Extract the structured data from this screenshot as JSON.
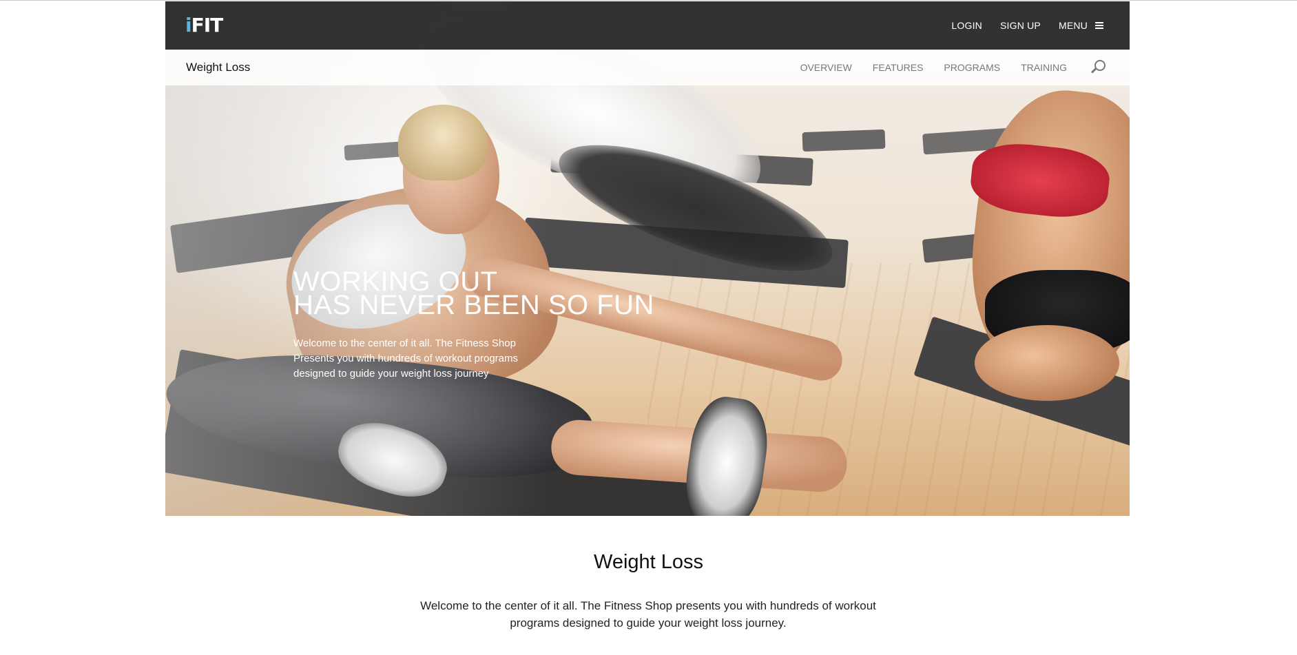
{
  "brand": {
    "logo_i": "i",
    "logo_rest": "FIT",
    "logo_i_color": "#5ab4e6"
  },
  "topnav": {
    "login": "LOGIN",
    "signup": "SIGN UP",
    "menu": "MENU",
    "menu_icon": "hamburger-icon"
  },
  "subnav": {
    "title": "Weight Loss",
    "items": [
      "OVERVIEW",
      "FEATURES",
      "PROGRAMS",
      "TRAINING"
    ],
    "search_icon": "search-icon"
  },
  "hero": {
    "headline_line1": "WORKING OUT",
    "headline_line2": "HAS NEVER BEEN SO FUN",
    "copy_line1": "Welcome to the center of it all. The Fitness Shop",
    "copy_line2": "Presents you with hundreds of workout programs",
    "copy_line3": "designed to guide your weight loss journey"
  },
  "section": {
    "title": "Weight Loss",
    "body_line1": "Welcome to the center of it all. The Fitness Shop presents you with hundreds of workout",
    "body_line2": "programs designed to guide your weight loss journey."
  },
  "colors": {
    "topbar": "#181818",
    "subnav_text": "#777777",
    "accent": "#5ab4e6"
  }
}
